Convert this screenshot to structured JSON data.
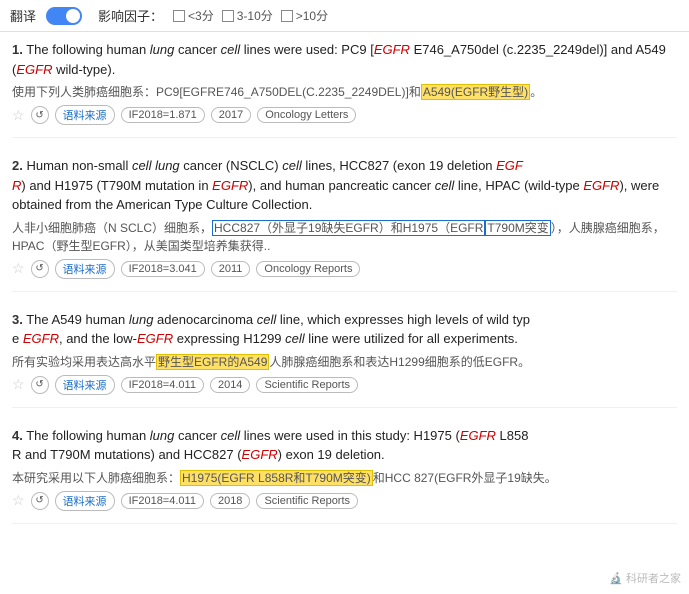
{
  "topbar": {
    "translate_label": "翻译",
    "if_label": "影响因子：",
    "options": [
      {
        "label": "<3分",
        "checked": false
      },
      {
        "label": "3-10分",
        "checked": false
      },
      {
        " label": ">10分",
        "checked": false
      }
    ]
  },
  "results": [
    {
      "number": "1.",
      "en": "The following human lung cancer cell lines were used: PC9 [EGFR E746_A750del (c.2235_2249del)] and A549 (EGFR wild-type).",
      "cn": "使用下列人类肺癌细胞系：PC9[EGFRE746_A750DEL(C.2235_2249DEL)]和A549(EGFR野生型)。",
      "highlight_cn": "A549(EGFR野生型)",
      "star": "☆",
      "meta_source": "语料来源",
      "meta_if": "IF2018=1.871",
      "meta_year": "2017",
      "meta_journal": "Oncology Letters"
    },
    {
      "number": "2.",
      "en": "Human non-small cell lung cancer (NSCLC) cell lines, HCC827 (exon 19 deletion EGFR) and H1975 (T790M mutation in EGFR), and human pancreatic cancer cell line, HPAC (wild-type EGFR), were obtained from the American Type Culture Collection.",
      "cn": "人非小细胞肺癌（N SCLC）细胞系，HCC827（外显子19缺失EGFR）和H1975（EGFR T790M突变），人胰腺癌细胞系，HPAC（野生型EGFR），从美国类型培养集获得..",
      "highlight_cn_boxes": [
        "HCC827（外显子19缺失EGFR）和H1975（EGFR",
        "T790M突变"
      ],
      "star": "☆",
      "meta_source": "语料来源",
      "meta_if": "IF2018=3.041",
      "meta_year": "2011",
      "meta_journal": "Oncology Reports"
    },
    {
      "number": "3.",
      "en": "The A549 human lung adenocarcinoma cell line, which expresses high levels of wild type EGFR, and the low-EGFR expressing H1299 cell line were utilized for all experiments.",
      "cn": "所有实验均采用表达高水平野生型EGFR的A549人肺腺癌细胞系和表达H1299细胞系的低EGFR。",
      "highlight_cn": "野生型EGFR的A549",
      "star": "☆",
      "meta_source": "语料来源",
      "meta_if": "IF2018=4.011",
      "meta_year": "2014",
      "meta_journal": "Scientific Reports"
    },
    {
      "number": "4.",
      "en": "The following human lung cancer cell lines were used in this study: H1975 (EGFR L858R and T790M mutations) and HCC827 (EGFR exon 19 deletion.",
      "cn": "本研究采用以下人肺癌细胞系：H1975(EGFR L858R和T790M突变)和HCC 827(EGFR外显子19缺失。",
      "highlight_cn": "H1975(EGFR L858R和T790M突变)",
      "star": "☆",
      "meta_source": "语料来源",
      "meta_if": "IF2018=4.011",
      "meta_year": "2018",
      "meta_journal": "Scientific Reports"
    }
  ],
  "watermark": "科研者之家"
}
